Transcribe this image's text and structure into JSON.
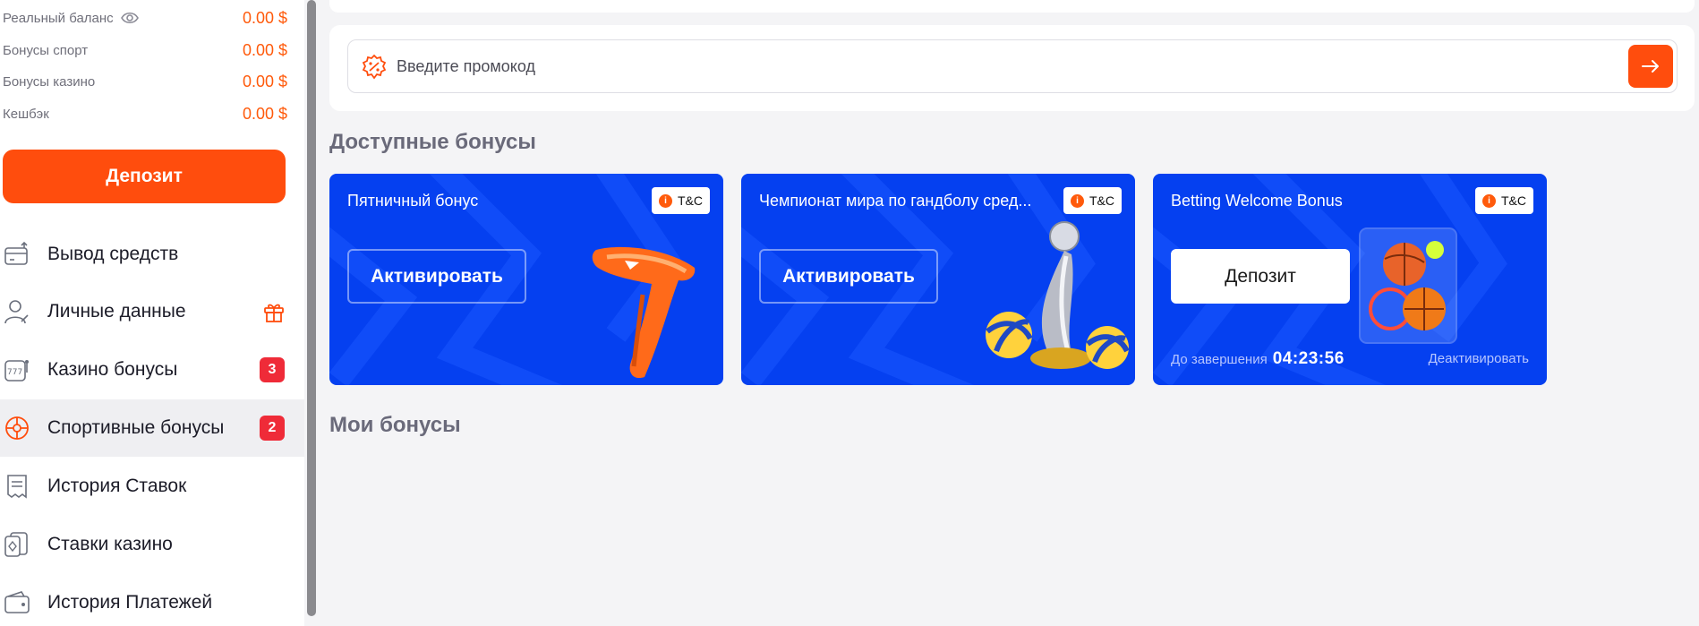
{
  "balances": [
    {
      "label": "Реальный баланс",
      "value": "0.00 $",
      "icon": "eye-icon"
    },
    {
      "label": "Бонусы спорт",
      "value": "0.00 $"
    },
    {
      "label": "Бонусы казино",
      "value": "0.00 $"
    },
    {
      "label": "Кешбэк",
      "value": "0.00 $"
    }
  ],
  "deposit_label": "Депозит",
  "nav": [
    {
      "label": "Вывод средств",
      "icon": "withdraw-icon"
    },
    {
      "label": "Личные данные",
      "icon": "user-icon",
      "extra_icon": "gift-icon"
    },
    {
      "label": "Казино бонусы",
      "icon": "slot-machine-icon",
      "badge": "3"
    },
    {
      "label": "Спортивные бонусы",
      "icon": "sport-ball-icon",
      "badge": "2",
      "active": true
    },
    {
      "label": "История Ставок",
      "icon": "receipt-icon"
    },
    {
      "label": "Ставки казино",
      "icon": "cards-icon"
    },
    {
      "label": "История Платежей",
      "icon": "wallet-icon"
    }
  ],
  "promo": {
    "placeholder": "Введите промокод",
    "value": ""
  },
  "sections": {
    "available": "Доступные бонусы",
    "mine": "Мои бонусы"
  },
  "cards": [
    {
      "title": "Пятничный бонус",
      "tc": "T&C",
      "button": "Активировать",
      "art": "boomerang-image"
    },
    {
      "title": "Чемпионат мира по гандболу сред...",
      "tc": "T&C",
      "button": "Активировать",
      "art": "trophy-balls-image"
    },
    {
      "title": "Betting Welcome Bonus",
      "tc": "T&C",
      "button": "Депозит",
      "art": "sports-gear-image",
      "timer_label": "До завершения",
      "timer": "04:23:56",
      "deactivate": "Деактивировать"
    }
  ],
  "colors": {
    "accent": "#ff4d0d",
    "card_blue": "#0540f0",
    "badge_red": "#ef2b38"
  }
}
